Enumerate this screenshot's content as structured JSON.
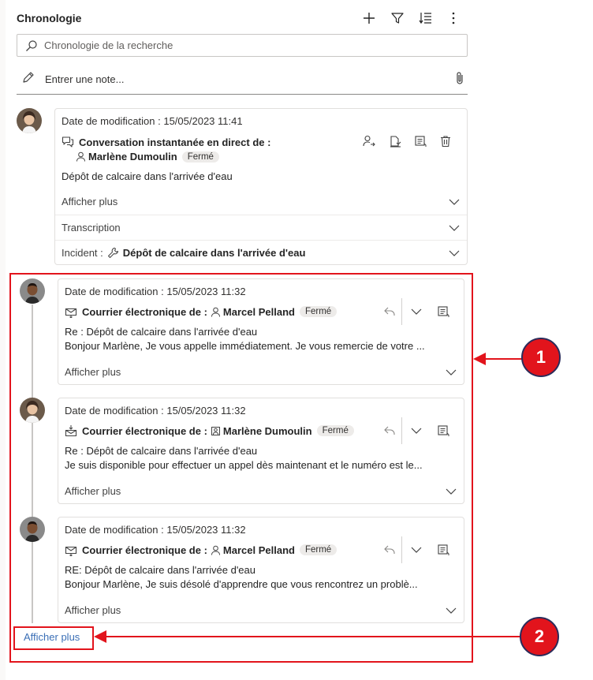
{
  "header": {
    "title": "Chronologie"
  },
  "search": {
    "placeholder": "Chronologie de la recherche"
  },
  "note": {
    "placeholder": "Entrer une note..."
  },
  "records": [
    {
      "date_text": "Date de modification : 15/05/2023 11:41",
      "type_label": "Conversation instantanée en direct de :",
      "person": "Marlène Dumoulin",
      "status": "Fermé",
      "body": [
        "Dépôt de calcaire dans l'arrivée d'eau"
      ],
      "expanders": [
        "Afficher plus",
        "Transcription"
      ],
      "incident_label": "Incident :",
      "incident_value": "Dépôt de calcaire dans l'arrivée d'eau"
    },
    {
      "date_text": "Date de modification : 15/05/2023 11:32",
      "type_label": "Courrier électronique de :",
      "person": "Marcel Pelland",
      "status": "Fermé",
      "body": [
        "Re : Dépôt de calcaire dans l'arrivée d'eau",
        "Bonjour Marlène, Je vous appelle immédiatement. Je vous remercie de votre ..."
      ],
      "expander": "Afficher plus"
    },
    {
      "date_text": "Date de modification : 15/05/2023 11:32",
      "type_label": "Courrier électronique de :",
      "person": "Marlène Dumoulin",
      "status": "Fermé",
      "body": [
        "Re : Dépôt de calcaire dans l'arrivée d'eau",
        "Je suis disponible pour effectuer un appel dès maintenant et le numéro est le..."
      ],
      "expander": "Afficher plus"
    },
    {
      "date_text": "Date de modification : 15/05/2023 11:32",
      "type_label": "Courrier électronique de :",
      "person": "Marcel Pelland",
      "status": "Fermé",
      "body": [
        "RE: Dépôt de calcaire dans l'arrivée d'eau",
        "Bonjour Marlène, Je suis désolé d'apprendre que vous rencontrez un problè..."
      ],
      "expander": "Afficher plus"
    }
  ],
  "show_more": "Afficher plus",
  "callouts": [
    "1",
    "2"
  ],
  "colors": {
    "callout_red": "#e2141c",
    "link_blue": "#3b6fb6",
    "pill_bg": "#edebe9"
  }
}
